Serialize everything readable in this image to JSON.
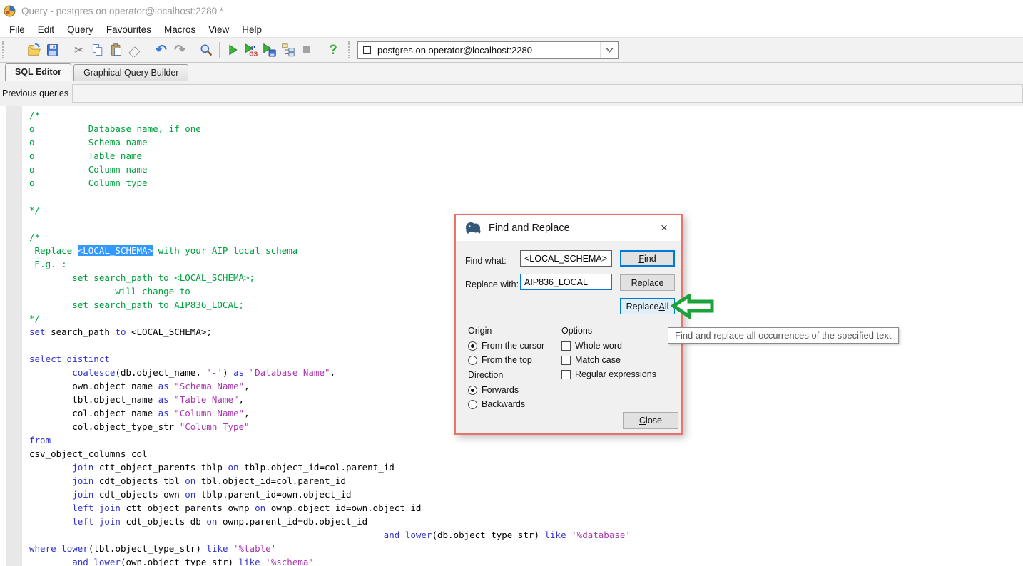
{
  "window": {
    "title": "Query - postgres on operator@localhost:2280 *"
  },
  "menu": {
    "items": [
      {
        "label": "File",
        "u": 0
      },
      {
        "label": "Edit",
        "u": 0
      },
      {
        "label": "Query",
        "u": 0
      },
      {
        "label": "Favourites",
        "u": 3
      },
      {
        "label": "Macros",
        "u": 0
      },
      {
        "label": "View",
        "u": 0
      },
      {
        "label": "Help",
        "u": 0
      }
    ]
  },
  "icons": {
    "undo": "↶",
    "redo": "↷",
    "cut": "✂",
    "help": "?",
    "chevron": "⌄",
    "close": "×"
  },
  "toolbar": {
    "connection": "postgres on operator@localhost:2280"
  },
  "tabs": [
    {
      "label": "SQL Editor",
      "active": true
    },
    {
      "label": "Graphical Query Builder",
      "active": false
    }
  ],
  "previous_queries_label": "Previous queries",
  "editor": {
    "lines": [
      [
        [
          "c",
          "/*"
        ]
      ],
      [
        [
          "c",
          "o          Database name, if one"
        ]
      ],
      [
        [
          "c",
          "o          Schema name"
        ]
      ],
      [
        [
          "c",
          "o          Table name"
        ]
      ],
      [
        [
          "c",
          "o          Column name"
        ]
      ],
      [
        [
          "c",
          "o          Column type"
        ]
      ],
      [],
      [
        [
          "c",
          "*/"
        ]
      ],
      [],
      [
        [
          "c",
          "/*"
        ]
      ],
      [
        [
          "c",
          " Replace "
        ],
        [
          "sel",
          "<LOCAL_SCHEMA>"
        ],
        [
          "c",
          " with your AIP local schema"
        ]
      ],
      [
        [
          "c",
          " E.g. :"
        ]
      ],
      [
        [
          "c",
          "        set search_path to <LOCAL_SCHEMA>;"
        ]
      ],
      [
        [
          "c",
          "                will change to"
        ]
      ],
      [
        [
          "c",
          "        set search_path to AIP836_LOCAL;"
        ]
      ],
      [
        [
          "c",
          "*/"
        ]
      ],
      [
        [
          "k",
          "set"
        ],
        [
          "p",
          " search_path "
        ],
        [
          "k",
          "to"
        ],
        [
          "p",
          " <LOCAL_SCHEMA>;"
        ]
      ],
      [],
      [
        [
          "k",
          "select distinct"
        ]
      ],
      [
        [
          "p",
          "        "
        ],
        [
          "k",
          "coalesce"
        ],
        [
          "p",
          "(db.object_name, "
        ],
        [
          "s",
          "'-'"
        ],
        [
          "p",
          ") "
        ],
        [
          "k",
          "as"
        ],
        [
          "p",
          " "
        ],
        [
          "s",
          "\"Database Name\""
        ],
        [
          "p",
          ","
        ]
      ],
      [
        [
          "p",
          "        own.object_name "
        ],
        [
          "k",
          "as"
        ],
        [
          "p",
          " "
        ],
        [
          "s",
          "\"Schema Name\""
        ],
        [
          "p",
          ","
        ]
      ],
      [
        [
          "p",
          "        tbl.object_name "
        ],
        [
          "k",
          "as"
        ],
        [
          "p",
          " "
        ],
        [
          "s",
          "\"Table Name\""
        ],
        [
          "p",
          ","
        ]
      ],
      [
        [
          "p",
          "        col.object_name "
        ],
        [
          "k",
          "as"
        ],
        [
          "p",
          " "
        ],
        [
          "s",
          "\"Column Name\""
        ],
        [
          "p",
          ","
        ]
      ],
      [
        [
          "p",
          "        col.object_type_str "
        ],
        [
          "s",
          "\"Column Type\""
        ]
      ],
      [
        [
          "k",
          "from"
        ]
      ],
      [
        [
          "p",
          "csv_object_columns col"
        ]
      ],
      [
        [
          "p",
          "        "
        ],
        [
          "k",
          "join"
        ],
        [
          "p",
          " ctt_object_parents tblp "
        ],
        [
          "k",
          "on"
        ],
        [
          "p",
          " tblp.object_id=col.parent_id"
        ]
      ],
      [
        [
          "p",
          "        "
        ],
        [
          "k",
          "join"
        ],
        [
          "p",
          " cdt_objects tbl "
        ],
        [
          "k",
          "on"
        ],
        [
          "p",
          " tbl.object_id=col.parent_id"
        ]
      ],
      [
        [
          "p",
          "        "
        ],
        [
          "k",
          "join"
        ],
        [
          "p",
          " cdt_objects own "
        ],
        [
          "k",
          "on"
        ],
        [
          "p",
          " tblp.parent_id=own.object_id"
        ]
      ],
      [
        [
          "p",
          "        "
        ],
        [
          "k",
          "left join"
        ],
        [
          "p",
          " ctt_object_parents ownp "
        ],
        [
          "k",
          "on"
        ],
        [
          "p",
          " ownp.object_id=own.object_id"
        ]
      ],
      [
        [
          "p",
          "        "
        ],
        [
          "k",
          "left join"
        ],
        [
          "p",
          " cdt_objects db "
        ],
        [
          "k",
          "on"
        ],
        [
          "p",
          " ownp.parent_id=db.object_id"
        ]
      ],
      [
        [
          "p",
          "                                                                  "
        ],
        [
          "k",
          "and"
        ],
        [
          "p",
          " "
        ],
        [
          "k",
          "lower"
        ],
        [
          "p",
          "(db.object_type_str) "
        ],
        [
          "k",
          "like"
        ],
        [
          "p",
          " "
        ],
        [
          "s",
          "'%database'"
        ]
      ],
      [
        [
          "k",
          "where"
        ],
        [
          "p",
          " "
        ],
        [
          "k",
          "lower"
        ],
        [
          "p",
          "(tbl.object_type_str) "
        ],
        [
          "k",
          "like"
        ],
        [
          "p",
          " "
        ],
        [
          "s",
          "'%table'"
        ]
      ],
      [
        [
          "p",
          "        "
        ],
        [
          "k",
          "and"
        ],
        [
          "p",
          " "
        ],
        [
          "k",
          "lower"
        ],
        [
          "p",
          "(own.object_type_str) "
        ],
        [
          "k",
          "like"
        ],
        [
          "p",
          " "
        ],
        [
          "s",
          "'%schema'"
        ]
      ]
    ]
  },
  "dialog": {
    "title": "Find and Replace",
    "find_label": "Find what:",
    "find_value": "<LOCAL_SCHEMA>",
    "replace_label": "Replace with:",
    "replace_value": "AIP836_LOCAL",
    "buttons": {
      "find": {
        "label": "Find",
        "u": 0
      },
      "replace": {
        "label": "Replace",
        "u": 0
      },
      "replace_all": {
        "label": "Replace All",
        "u": 8
      },
      "close": {
        "label": "Close",
        "u": 0
      }
    },
    "origin": {
      "label": "Origin",
      "options": [
        {
          "label": "From the cursor",
          "selected": true
        },
        {
          "label": "From the top",
          "selected": false
        }
      ]
    },
    "direction": {
      "label": "Direction",
      "options": [
        {
          "label": "Forwards",
          "selected": true
        },
        {
          "label": "Backwards",
          "selected": false
        }
      ]
    },
    "options": {
      "label": "Options",
      "checkboxes": [
        {
          "label": "Whole word",
          "checked": false
        },
        {
          "label": "Match case",
          "checked": false
        },
        {
          "label": "Regular expressions",
          "checked": false
        }
      ]
    }
  },
  "tooltip": {
    "text": "Find and replace all occurrences of the specified text"
  },
  "colors": {
    "selection": "#3399fe",
    "comment": "#00a03c",
    "keyword": "#3133cb",
    "string": "#ab37ad",
    "accent": "#0078d7",
    "annotation_red": "#e8736b",
    "annotation_green": "#1ba23a"
  }
}
